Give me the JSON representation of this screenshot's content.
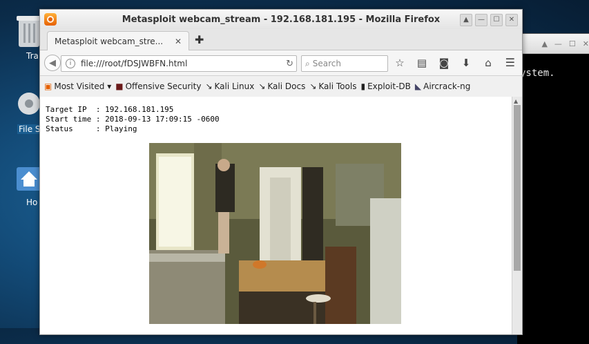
{
  "desktop": {
    "icons": [
      {
        "name": "trash",
        "label": "Tra"
      },
      {
        "name": "filesystem",
        "label": "File Sy"
      },
      {
        "name": "home",
        "label": "Ho"
      }
    ]
  },
  "terminal": {
    "text": "ystem."
  },
  "window": {
    "title": "Metasploit webcam_stream - 192.168.181.195 - Mozilla Firefox"
  },
  "tab": {
    "label": "Metasploit webcam_stre...",
    "close": "✕"
  },
  "newtab": {
    "label": "✚"
  },
  "navbar": {
    "url": "file:///root/fDSJWBFN.html",
    "search_placeholder": "Search"
  },
  "bookmarks": [
    {
      "label": "Most Visited ▾",
      "icon": "most-visited-icon"
    },
    {
      "label": "Offensive Security",
      "icon": "offsec-icon"
    },
    {
      "label": "Kali Linux",
      "icon": "kali-dragon-icon"
    },
    {
      "label": "Kali Docs",
      "icon": "kali-dragon-icon"
    },
    {
      "label": "Kali Tools",
      "icon": "kali-dragon-icon"
    },
    {
      "label": "Exploit-DB",
      "icon": "exploitdb-icon"
    },
    {
      "label": "Aircrack-ng",
      "icon": "aircrack-icon"
    }
  ],
  "page": {
    "info": "Target IP  : 192.168.181.195\nStart time : 2018-09-13 17:09:15 -0600\nStatus     : Playing"
  },
  "colors": {
    "firefox_orange": "#e66000",
    "desktop_blue": "#134b78"
  }
}
